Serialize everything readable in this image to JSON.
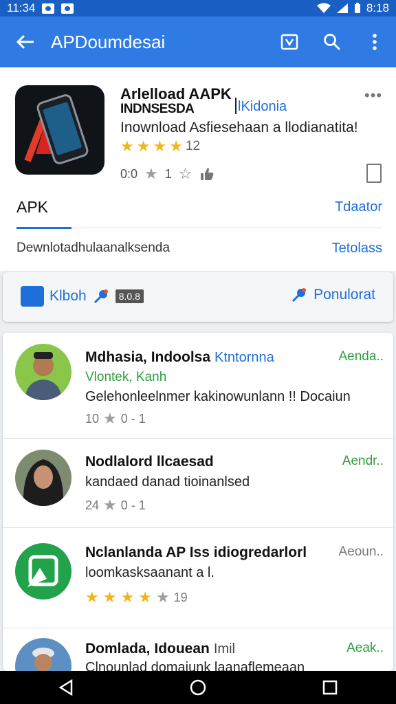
{
  "status": {
    "time": "11:34",
    "right": "8:18"
  },
  "appbar": {
    "title": "APDoumdesai"
  },
  "app": {
    "name": "Arlelload AAPK",
    "subtitle": "INDNSESDA",
    "developer": "lKidonia",
    "description": "Inownload Asfiesehaan a llodianatita!",
    "rating_count": "12",
    "meta_left": "0:0",
    "meta_mid": "1"
  },
  "tabs": {
    "active": "APK",
    "right": "Tdaator"
  },
  "download": {
    "text": "Dewnlotadhulaanalksenda",
    "right": "Tetolass"
  },
  "actions": {
    "left_label": "Klboh",
    "size": "8.0.8",
    "right_label": "Ponulorat"
  },
  "list": [
    {
      "name": "Mdhasia, Indoolsa",
      "tag": "Ktntornna",
      "badge": "Aenda..",
      "sub": "Vlontek, Kanh",
      "msg": "Gelehonleelnmer kakinowunlann !! Docaiun",
      "meta_count": "10",
      "meta_val": "0 - 1"
    },
    {
      "name": "Nodlalord llcaesad",
      "tag": "",
      "badge": "Aendr..",
      "sub": "",
      "msg": "kandaed danad tioinanlsed",
      "meta_count": "24",
      "meta_val": "0 - 1"
    },
    {
      "name": "Nclanlanda AP Iss idiogredarlorl",
      "tag": "",
      "badge": "Aeoun..",
      "sub": "",
      "msg": "loomkasksaanant a l.",
      "meta_count": "19",
      "meta_val": ""
    },
    {
      "name": "Domlada, Idouean",
      "tag": "Imil",
      "badge": "Aeak..",
      "sub": "",
      "msg": "Clnounlad domaiunk laanaflemeaan",
      "meta_count": "",
      "meta_val": ""
    }
  ],
  "colors": {
    "appbar": "#2f7be3",
    "statusbar": "#1a5fc4",
    "accent": "#1e6fd9",
    "green": "#2e9e3e",
    "star": "#f3b41a"
  }
}
